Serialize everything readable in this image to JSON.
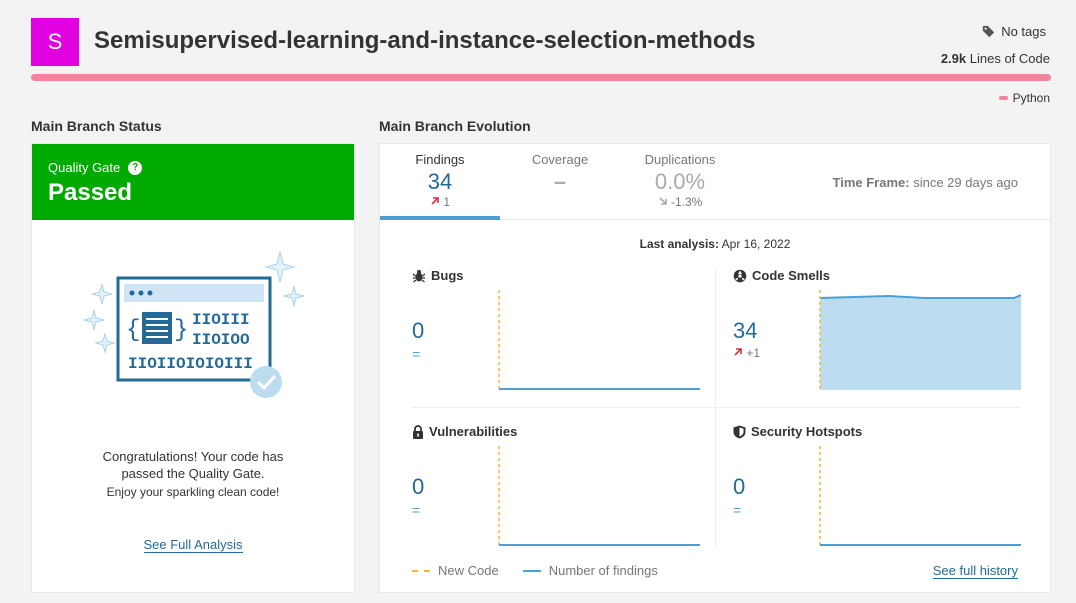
{
  "project": {
    "avatar_letter": "S",
    "avatar_color": "#e000e0",
    "name": "Semisupervised-learning-and-instance-selection-methods",
    "tags": "No tags",
    "loc_value": "2.9k",
    "loc_label": "Lines of Code",
    "language": "Python",
    "language_color": "#f0849c"
  },
  "status": {
    "section_title": "Main Branch Status",
    "qg_label": "Quality Gate",
    "qg_help": "?",
    "qg_value": "Passed",
    "qg_color": "#00aa00",
    "congrats_line1": "Congratulations! Your code has",
    "congrats_line2": "passed the Quality Gate.",
    "congrats_sub": "Enjoy your sparkling clean code!",
    "full_analysis": "See Full Analysis"
  },
  "evolution": {
    "section_title": "Main Branch Evolution",
    "tabs": [
      {
        "title": "Findings",
        "value": "34",
        "delta": "1",
        "delta_icon": "arrow-up-icon"
      },
      {
        "title": "Coverage",
        "value": "–",
        "delta": "",
        "delta_icon": ""
      },
      {
        "title": "Duplications",
        "value": "0.0%",
        "delta": "-1.3%",
        "delta_icon": "arrow-down-icon"
      }
    ],
    "timeframe_label": "Time Frame:",
    "timeframe_value": "since 29 days ago",
    "last_analysis_label": "Last analysis:",
    "last_analysis_value": "Apr 16, 2022",
    "metrics": [
      {
        "title": "Bugs",
        "icon": "bug-icon",
        "value": "0",
        "delta": "="
      },
      {
        "title": "Code Smells",
        "icon": "code-smell-icon",
        "value": "34",
        "delta": "+1"
      },
      {
        "title": "Vulnerabilities",
        "icon": "lock-icon",
        "value": "0",
        "delta": "="
      },
      {
        "title": "Security Hotspots",
        "icon": "shield-icon",
        "value": "0",
        "delta": "="
      }
    ],
    "legend_new_code": "New Code",
    "legend_findings": "Number of findings",
    "history_link": "See full history",
    "colors": {
      "accent": "#236a97",
      "line": "#4b9fd5",
      "new_code": "#f3b83a",
      "area": "#bcdcf0",
      "up_arrow": "#d4333f"
    }
  }
}
